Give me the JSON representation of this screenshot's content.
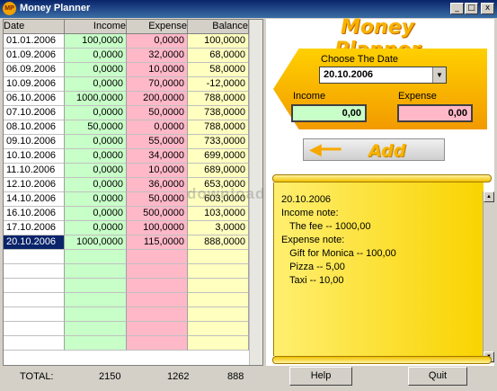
{
  "window": {
    "title": "Money Planner",
    "icon_text": "MP",
    "buttons": [
      "_",
      "□",
      "x"
    ]
  },
  "grid": {
    "headers": [
      "Date",
      "Income",
      "Expense",
      "Balance"
    ],
    "rows": [
      [
        "01.01.2006",
        "100,0000",
        "0,0000",
        "100,0000"
      ],
      [
        "01.09.2006",
        "0,0000",
        "32,0000",
        "68,0000"
      ],
      [
        "06.09.2006",
        "0,0000",
        "10,0000",
        "58,0000"
      ],
      [
        "10.09.2006",
        "0,0000",
        "70,0000",
        "-12,0000"
      ],
      [
        "06.10.2006",
        "1000,0000",
        "200,0000",
        "788,0000"
      ],
      [
        "07.10.2006",
        "0,0000",
        "50,0000",
        "738,0000"
      ],
      [
        "08.10.2006",
        "50,0000",
        "0,0000",
        "788,0000"
      ],
      [
        "09.10.2006",
        "0,0000",
        "55,0000",
        "733,0000"
      ],
      [
        "10.10.2006",
        "0,0000",
        "34,0000",
        "699,0000"
      ],
      [
        "11.10.2006",
        "0,0000",
        "10,0000",
        "689,0000"
      ],
      [
        "12.10.2006",
        "0,0000",
        "36,0000",
        "653,0000"
      ],
      [
        "14.10.2006",
        "0,0000",
        "50,0000",
        "603,0000"
      ],
      [
        "16.10.2006",
        "0,0000",
        "500,0000",
        "103,0000"
      ],
      [
        "17.10.2006",
        "0,0000",
        "100,0000",
        "3,0000"
      ],
      [
        "20.10.2006",
        "1000,0000",
        "115,0000",
        "888,0000"
      ]
    ],
    "selected_row": 14,
    "empty_rows": 7
  },
  "totals": {
    "label": "TOTAL:",
    "income": "2150",
    "expense": "1262",
    "balance": "888"
  },
  "panel": {
    "logo": "Money Planner",
    "choose_label": "Choose The Date",
    "date_value": "20.10.2006",
    "income_label": "Income",
    "expense_label": "Expense",
    "income_value": "0,00",
    "expense_value": "0,00",
    "add_label": "Add"
  },
  "note": {
    "lines": [
      "20.10.2006",
      "Income note:",
      "   The fee -- 1000,00",
      "Expense note:",
      "   Gift for Monica -- 100,00",
      "   Pizza -- 5,00",
      "   Taxi -- 10,00"
    ]
  },
  "buttons": {
    "help": "Help",
    "quit": "Quit"
  },
  "watermark": "download",
  "colors": {
    "income": "#c8ffc8",
    "expense": "#ffb8c8",
    "balance": "#ffffc0",
    "accent": "#f7b300"
  }
}
